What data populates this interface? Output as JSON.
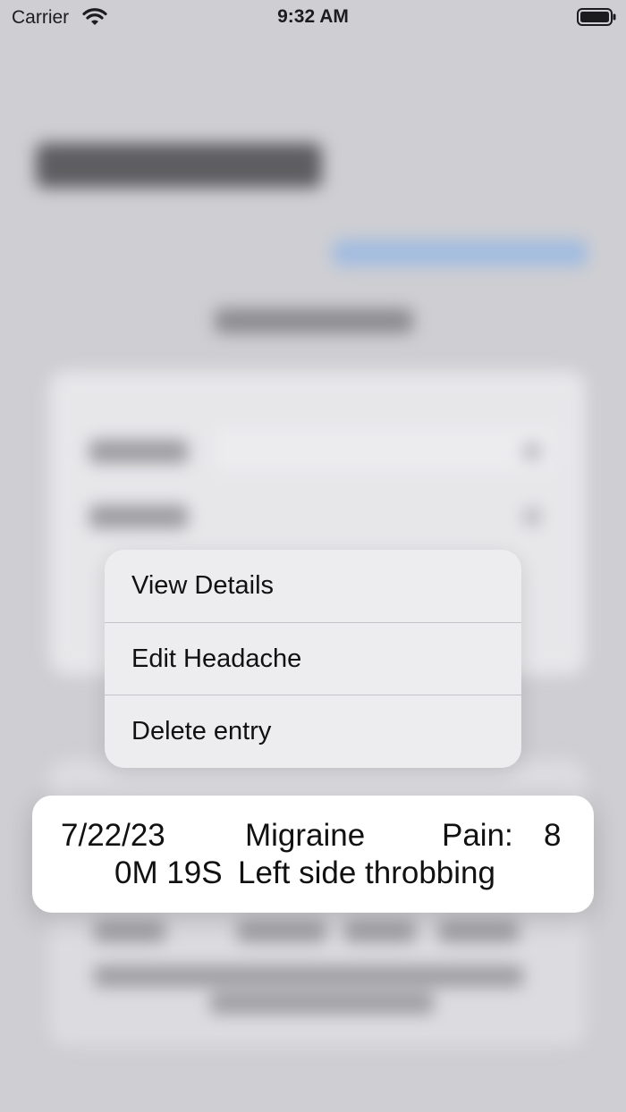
{
  "status_bar": {
    "carrier": "Carrier",
    "time": "9:32 AM",
    "wifi_icon": "wifi-icon",
    "battery_icon": "battery-icon"
  },
  "context_menu": {
    "items": [
      {
        "label": "View Details"
      },
      {
        "label": "Edit Headache"
      },
      {
        "label": "Delete entry"
      }
    ]
  },
  "preview": {
    "date": "7/22/23",
    "type": "Migraine",
    "pain_label": "Pain:",
    "pain_value": "8",
    "duration": "0M 19S",
    "note": "Left side throbbing"
  },
  "colors": {
    "background": "#cfcfd3",
    "menu_background": "#ededf0",
    "card_background": "#ffffff",
    "text": "#111111"
  }
}
